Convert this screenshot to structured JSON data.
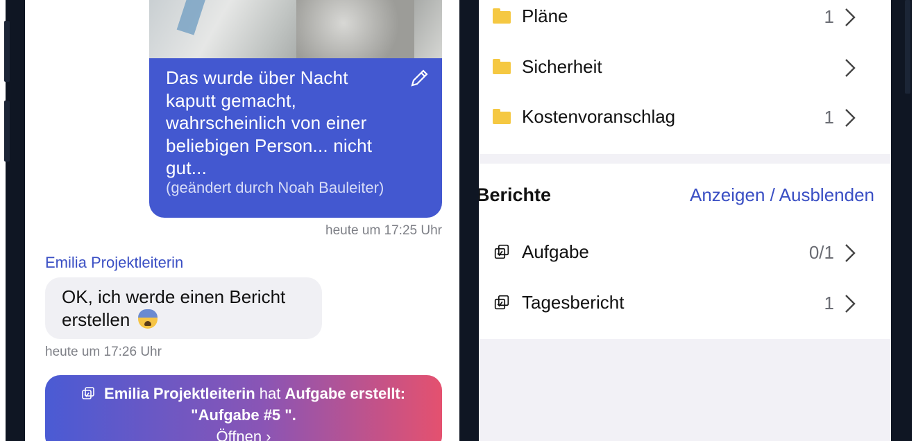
{
  "left_chat": {
    "photo_message": {
      "text": "Das wurde über Nacht kaputt gemacht, wahrscheinlich von einer beliebigen Person... nicht gut...",
      "edited_note": "(geändert durch Noah Bauleiter)",
      "timestamp": "heute um 17:25 Uhr"
    },
    "reply": {
      "sender": "Emilia Projektleiterin",
      "text": "OK, ich werde einen Bericht erstellen",
      "timestamp": "heute um 17:26 Uhr"
    },
    "task_notice": {
      "actor": "Emilia Projektleiterin",
      "verb": "hat",
      "action": "Aufgabe erstellt:",
      "task_name": "\"Aufgabe #5 \".",
      "open_label": "Öffnen"
    },
    "colors": {
      "bubble_blue": "#4358d0",
      "accent": "#3a4fc4",
      "gradient_start": "#4a5bd4",
      "gradient_end": "#e4516f"
    }
  },
  "right_panel": {
    "folders": [
      {
        "label": "Pläne",
        "count": "1",
        "icon": "folder-icon"
      },
      {
        "label": "Sicherheit",
        "count": "",
        "icon": "folder-icon"
      },
      {
        "label": "Kostenvoranschlag",
        "count": "1",
        "icon": "folder-icon"
      }
    ],
    "reports_section": {
      "title": "Berichte",
      "action": "Anzeigen / Ausblenden",
      "items": [
        {
          "label": "Aufgabe",
          "count": "0/1",
          "icon": "task-check-icon"
        },
        {
          "label": "Tagesbericht",
          "count": "1",
          "icon": "task-check-icon"
        }
      ]
    },
    "colors": {
      "folder": "#f5c842",
      "link": "#3a4fc4",
      "background": "#f2f1f6"
    }
  }
}
